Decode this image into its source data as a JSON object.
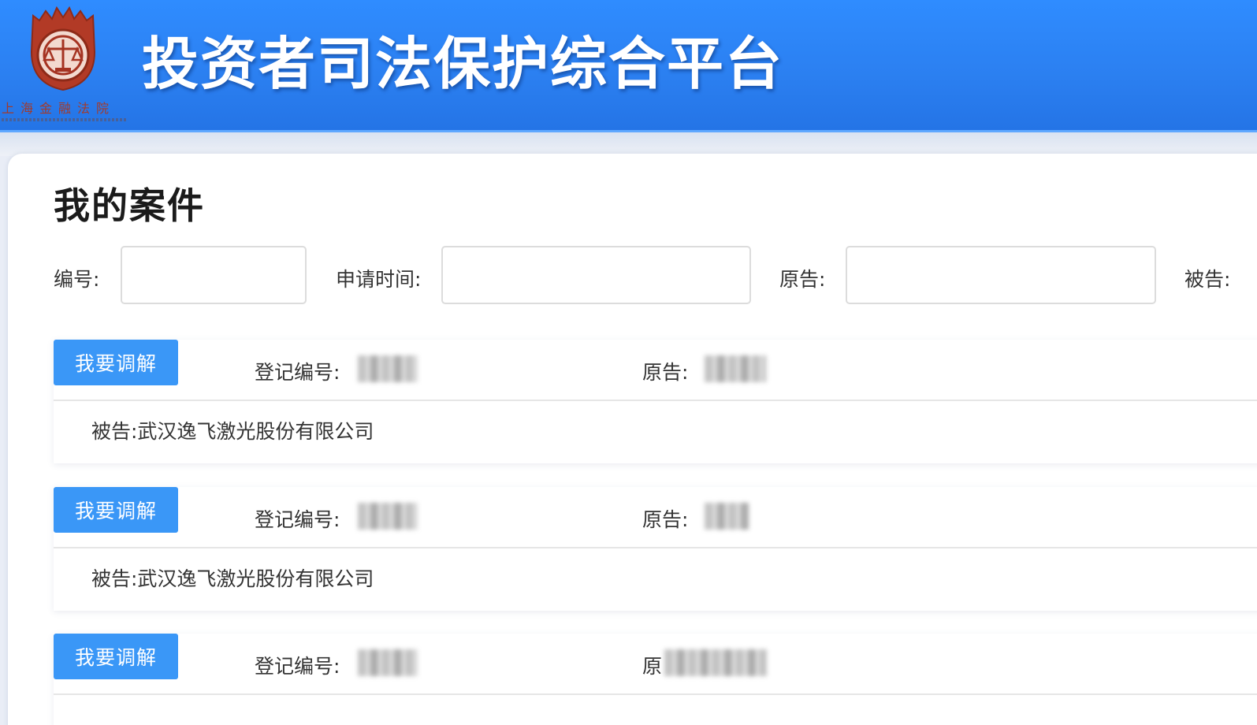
{
  "header": {
    "title": "投资者司法保护综合平台",
    "logo_text": "上海金融法院",
    "logo_name": "shanghai-financial-court-emblem",
    "brand_color": "#2f8cff"
  },
  "main": {
    "page_title": "我的案件",
    "filters": [
      {
        "label": "编号:",
        "value": "",
        "placeholder": ""
      },
      {
        "label": "申请时间:",
        "value": "",
        "placeholder": ""
      },
      {
        "label": "原告:",
        "value": "",
        "placeholder": ""
      },
      {
        "label": "被告:"
      }
    ],
    "cases": [
      {
        "button": "我要调解",
        "reg_label": "登记编号:",
        "plaintiff_label": "原告:",
        "defendant": "被告:武汉逸飞激光股份有限公司"
      },
      {
        "button": "我要调解",
        "reg_label": "登记编号:",
        "plaintiff_label": "原告:",
        "defendant": "被告:武汉逸飞激光股份有限公司"
      },
      {
        "button": "我要调解",
        "reg_label": "登记编号:",
        "plaintiff_label": "原"
      }
    ],
    "accent_color": "#3a97f7"
  }
}
